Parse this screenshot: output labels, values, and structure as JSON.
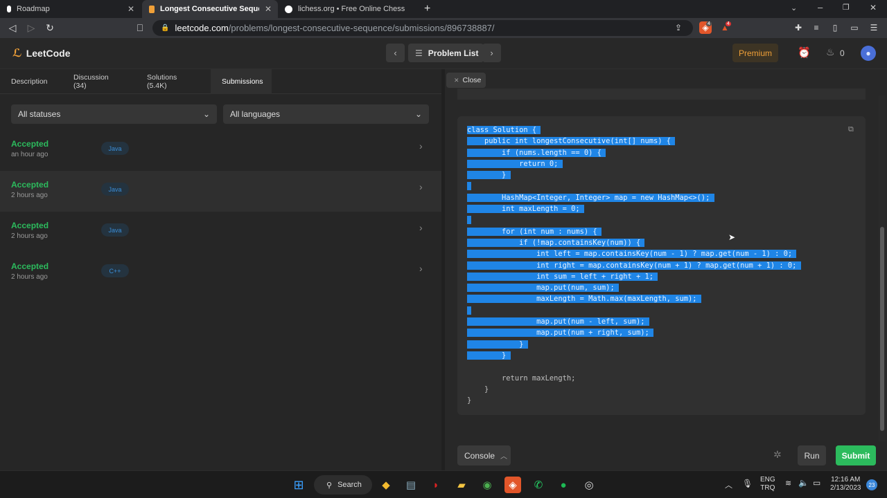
{
  "browser": {
    "tabs": [
      {
        "title": "Roadmap"
      },
      {
        "title": "Longest Consecutive Sequence - L"
      },
      {
        "title": "lichess.org • Free Online Chess"
      }
    ],
    "url_host": "leetcode.com",
    "url_path": "/problems/longest-consecutive-sequence/submissions/896738887/",
    "ext_badge_1": "4",
    "ext_badge_2": "4"
  },
  "header": {
    "logo": "LeetCode",
    "problem_list": "Problem List",
    "premium": "Premium",
    "streak": "0"
  },
  "left": {
    "tabs": [
      "Description",
      "Discussion (34)",
      "Solutions (5.4K)",
      "Submissions"
    ],
    "filters": {
      "status": "All statuses",
      "language": "All languages"
    },
    "submissions": [
      {
        "status": "Accepted",
        "when": "an hour ago",
        "lang": "Java"
      },
      {
        "status": "Accepted",
        "when": "2 hours ago",
        "lang": "Java"
      },
      {
        "status": "Accepted",
        "when": "2 hours ago",
        "lang": "Java"
      },
      {
        "status": "Accepted",
        "when": "2 hours ago",
        "lang": "C++"
      }
    ]
  },
  "right": {
    "close": "Close",
    "code_lines": [
      "class Solution {",
      "    public int longestConsecutive(int[] nums) {",
      "        if (nums.length == 0) {",
      "            return 0;",
      "        }",
      "",
      "        HashMap<Integer, Integer> map = new HashMap<>();",
      "        int maxLength = 0;",
      "",
      "        for (int num : nums) {",
      "            if (!map.containsKey(num)) {",
      "                int left = map.containsKey(num - 1) ? map.get(num - 1) : 0;",
      "                int right = map.containsKey(num + 1) ? map.get(num + 1) : 0;",
      "                int sum = left + right + 1;",
      "                map.put(num, sum);",
      "                maxLength = Math.max(maxLength, sum);",
      "",
      "                map.put(num - left, sum);",
      "                map.put(num + right, sum);",
      "            }",
      "        }",
      "",
      "        return maxLength;",
      "    }",
      "}"
    ],
    "console": "Console",
    "run": "Run",
    "submit": "Submit"
  },
  "taskbar": {
    "search": "Search",
    "lang_1": "ENG",
    "lang_2": "TRQ",
    "time": "12:16 AM",
    "date": "2/13/2023",
    "notif": "23"
  },
  "colors": {
    "accepted": "#2cbb5d",
    "selection": "#1f85e6",
    "premium": "#f0a038"
  }
}
